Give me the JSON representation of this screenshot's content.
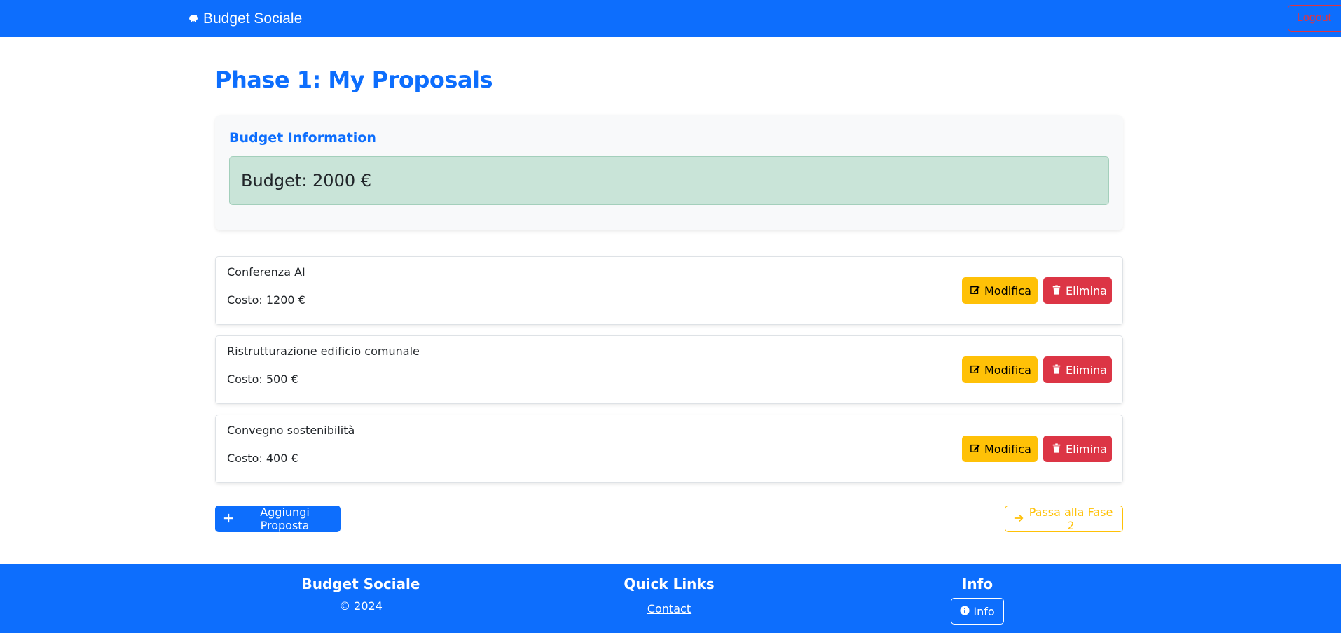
{
  "navbar": {
    "brand": "Budget Sociale",
    "logout_label": "Logout"
  },
  "page": {
    "title": "Phase 1: My Proposals"
  },
  "budget": {
    "heading": "Budget Information",
    "text": "Budget: 2000 €"
  },
  "proposals": [
    {
      "name": "Conferenza AI",
      "cost": "Costo: 1200 €",
      "edit_label": "Modifica",
      "delete_label": "Elimina"
    },
    {
      "name": "Ristrutturazione edificio comunale",
      "cost": "Costo: 500 €",
      "edit_label": "Modifica",
      "delete_label": "Elimina"
    },
    {
      "name": "Convegno sostenibilità",
      "cost": "Costo: 400 €",
      "edit_label": "Modifica",
      "delete_label": "Elimina"
    }
  ],
  "actions": {
    "add_label": "Aggiungi Proposta",
    "next_label": "Passa alla Fase 2"
  },
  "footer": {
    "col1_title": "Budget Sociale",
    "copyright": "© 2024",
    "col2_title": "Quick Links",
    "contact_label": "Contact",
    "col3_title": "Info",
    "info_label": "Info"
  },
  "colors": {
    "primary": "#0d6efd",
    "warning": "#ffc107",
    "danger": "#dc3545",
    "success_bg": "#c9e4d8"
  },
  "icons": {
    "brand": "piggy-bank-icon",
    "edit": "pencil-square-icon",
    "delete": "trash-icon",
    "add": "plus-icon",
    "next": "arrow-right-icon",
    "info": "info-circle-icon"
  }
}
